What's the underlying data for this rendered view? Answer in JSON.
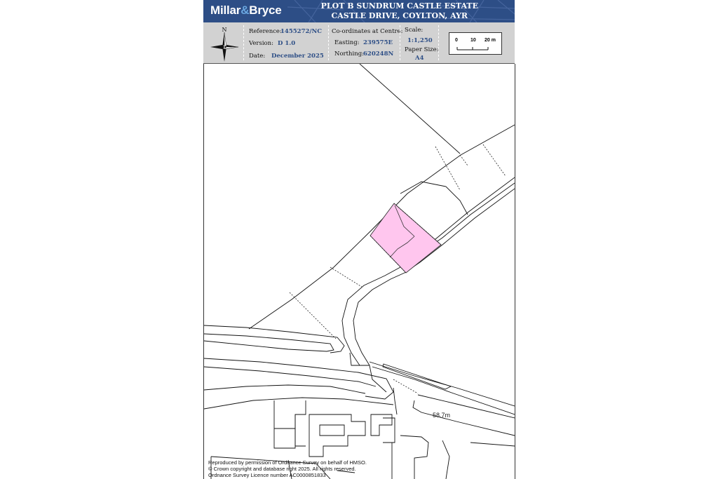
{
  "header": {
    "brand_left": "Millar",
    "brand_amp": "&",
    "brand_right": "Bryce",
    "title_line1": "PLOT B SUNDRUM CASTLE ESTATE",
    "title_line2": "CASTLE DRIVE, COYLTON, AYR"
  },
  "info": {
    "compass_label": "N",
    "reference_label": "Reference:",
    "reference_value": "1455272/NC",
    "version_label": "Version:",
    "version_value": "D 1.0",
    "date_label": "Date:",
    "date_value": "December 2025",
    "coords_label": "Co-ordinates at Centre:",
    "easting_label": "Easting:",
    "easting_value": "239575E",
    "northing_label": "Northing:",
    "northing_value": "620248N",
    "scale_label": "Scale:",
    "scale_value": "1:1,250",
    "paper_label": "Paper Size:",
    "paper_value": "A4",
    "scalebar_ticks": [
      "0",
      "10",
      "20 m"
    ]
  },
  "map": {
    "plot_color": "#ffc6ee",
    "spot_height": "58.7m",
    "copyright_line1": "Reproduced by permission of Ordnance Survey on behalf of HMSO.",
    "copyright_line2": "© Crown copyright and database right 2025. All rights reserved.",
    "copyright_line3": "Ordnance Survey Licence number AC0000851833"
  },
  "colors": {
    "brand_blue": "#2d4e86",
    "info_grey": "#d2d2d2"
  }
}
